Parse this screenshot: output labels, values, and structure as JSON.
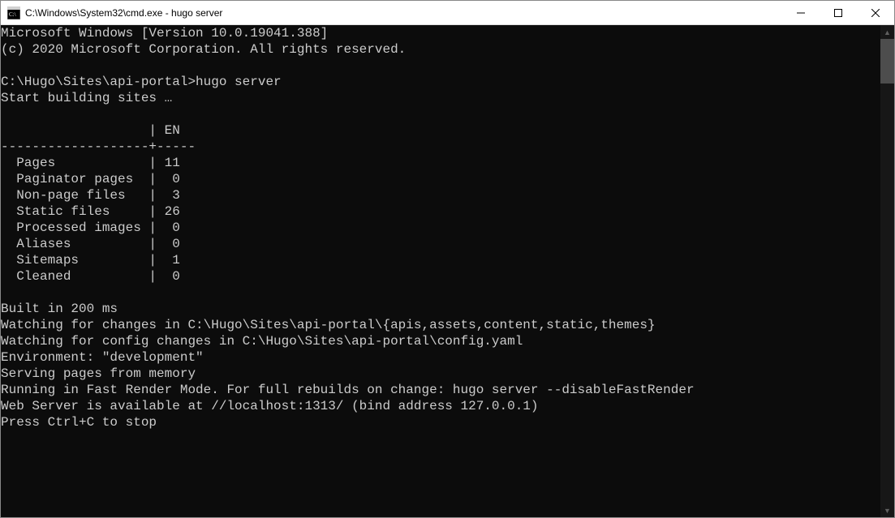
{
  "titlebar": {
    "title": "C:\\Windows\\System32\\cmd.exe - hugo  server"
  },
  "terminal": {
    "lines": [
      "Microsoft Windows [Version 10.0.19041.388]",
      "(c) 2020 Microsoft Corporation. All rights reserved.",
      "",
      "C:\\Hugo\\Sites\\api-portal>hugo server",
      "Start building sites …",
      "",
      "                   | EN",
      "-------------------+-----",
      "  Pages            | 11",
      "  Paginator pages  |  0",
      "  Non-page files   |  3",
      "  Static files     | 26",
      "  Processed images |  0",
      "  Aliases          |  0",
      "  Sitemaps         |  1",
      "  Cleaned          |  0",
      "",
      "Built in 200 ms",
      "Watching for changes in C:\\Hugo\\Sites\\api-portal\\{apis,assets,content,static,themes}",
      "Watching for config changes in C:\\Hugo\\Sites\\api-portal\\config.yaml",
      "Environment: \"development\"",
      "Serving pages from memory",
      "Running in Fast Render Mode. For full rebuilds on change: hugo server --disableFastRender",
      "Web Server is available at //localhost:1313/ (bind address 127.0.0.1)",
      "Press Ctrl+C to stop",
      ""
    ]
  }
}
